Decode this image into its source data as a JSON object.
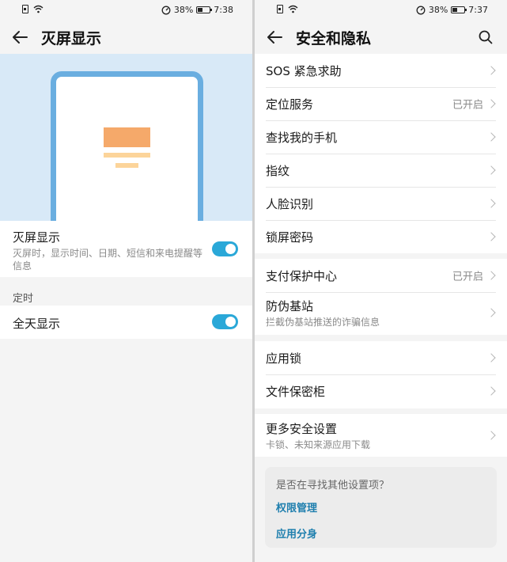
{
  "left": {
    "status": {
      "battery": "38%",
      "time": "7:38"
    },
    "header": {
      "title": "灭屏显示"
    },
    "aod": {
      "title": "灭屏显示",
      "subtitle": "灭屏时，显示时间、日期、短信和来电提醒等信息",
      "enabled": true
    },
    "timing": {
      "section": "定时",
      "all_day": "全天显示",
      "all_day_enabled": true
    }
  },
  "right": {
    "status": {
      "battery": "38%",
      "time": "7:37"
    },
    "header": {
      "title": "安全和隐私"
    },
    "group1": [
      {
        "label": "SOS 紧急求助",
        "value": ""
      },
      {
        "label": "定位服务",
        "value": "已开启"
      },
      {
        "label": "查找我的手机",
        "value": ""
      },
      {
        "label": "指纹",
        "value": ""
      },
      {
        "label": "人脸识别",
        "value": ""
      },
      {
        "label": "锁屏密码",
        "value": ""
      }
    ],
    "group2": {
      "pay": {
        "label": "支付保护中心",
        "value": "已开启"
      },
      "station": {
        "label": "防伪基站",
        "sub": "拦截伪基站推送的诈骗信息"
      }
    },
    "group3": [
      {
        "label": "应用锁"
      },
      {
        "label": "文件保密柜"
      }
    ],
    "group4": {
      "label": "更多安全设置",
      "sub": "卡锁、未知来源应用下载"
    },
    "suggest": {
      "question": "是否在寻找其他设置项？",
      "link1": "权限管理",
      "link2": "应用分身"
    }
  },
  "colors": {
    "accent": "#2aa8d8",
    "link": "#1f7fae",
    "hero_bg": "#d8e9f7",
    "phone_frame": "#6aaee0"
  },
  "icons": [
    "back-arrow-icon",
    "search-icon",
    "chevron-right-icon",
    "wifi-icon",
    "battery-icon",
    "sim-icon",
    "data-saver-icon"
  ]
}
